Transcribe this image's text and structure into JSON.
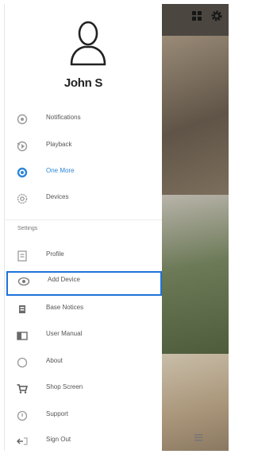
{
  "user": {
    "name": "John S"
  },
  "main_menu": [
    {
      "id": "notifications",
      "label": "Notifications",
      "icon": "bell-icon"
    },
    {
      "id": "playback",
      "label": "Playback",
      "icon": "playback-icon"
    },
    {
      "id": "one-more",
      "label": "One More",
      "icon": "radio-icon",
      "active": true
    },
    {
      "id": "devices",
      "label": "Devices",
      "icon": "camera-settings-icon"
    }
  ],
  "settings_section": {
    "label": "Settings"
  },
  "settings_menu": [
    {
      "id": "profile",
      "label": "Profile",
      "icon": "profile-icon"
    },
    {
      "id": "add-device",
      "label": "Add Device",
      "icon": "add-device-icon",
      "highlighted": true
    },
    {
      "id": "base-notices",
      "label": "Base Notices",
      "icon": "base-icon"
    },
    {
      "id": "user-manual",
      "label": "User Manual",
      "icon": "manual-icon"
    },
    {
      "id": "about",
      "label": "About",
      "icon": "info-icon"
    },
    {
      "id": "shop",
      "label": "Shop Screen",
      "icon": "cart-icon"
    },
    {
      "id": "support",
      "label": "Support",
      "icon": "support-icon"
    },
    {
      "id": "sign-out",
      "label": "Sign Out",
      "icon": "sign-out-icon"
    }
  ],
  "colors": {
    "accent": "#2f86d8",
    "highlight_border": "#1e73d8",
    "text": "#555555"
  }
}
